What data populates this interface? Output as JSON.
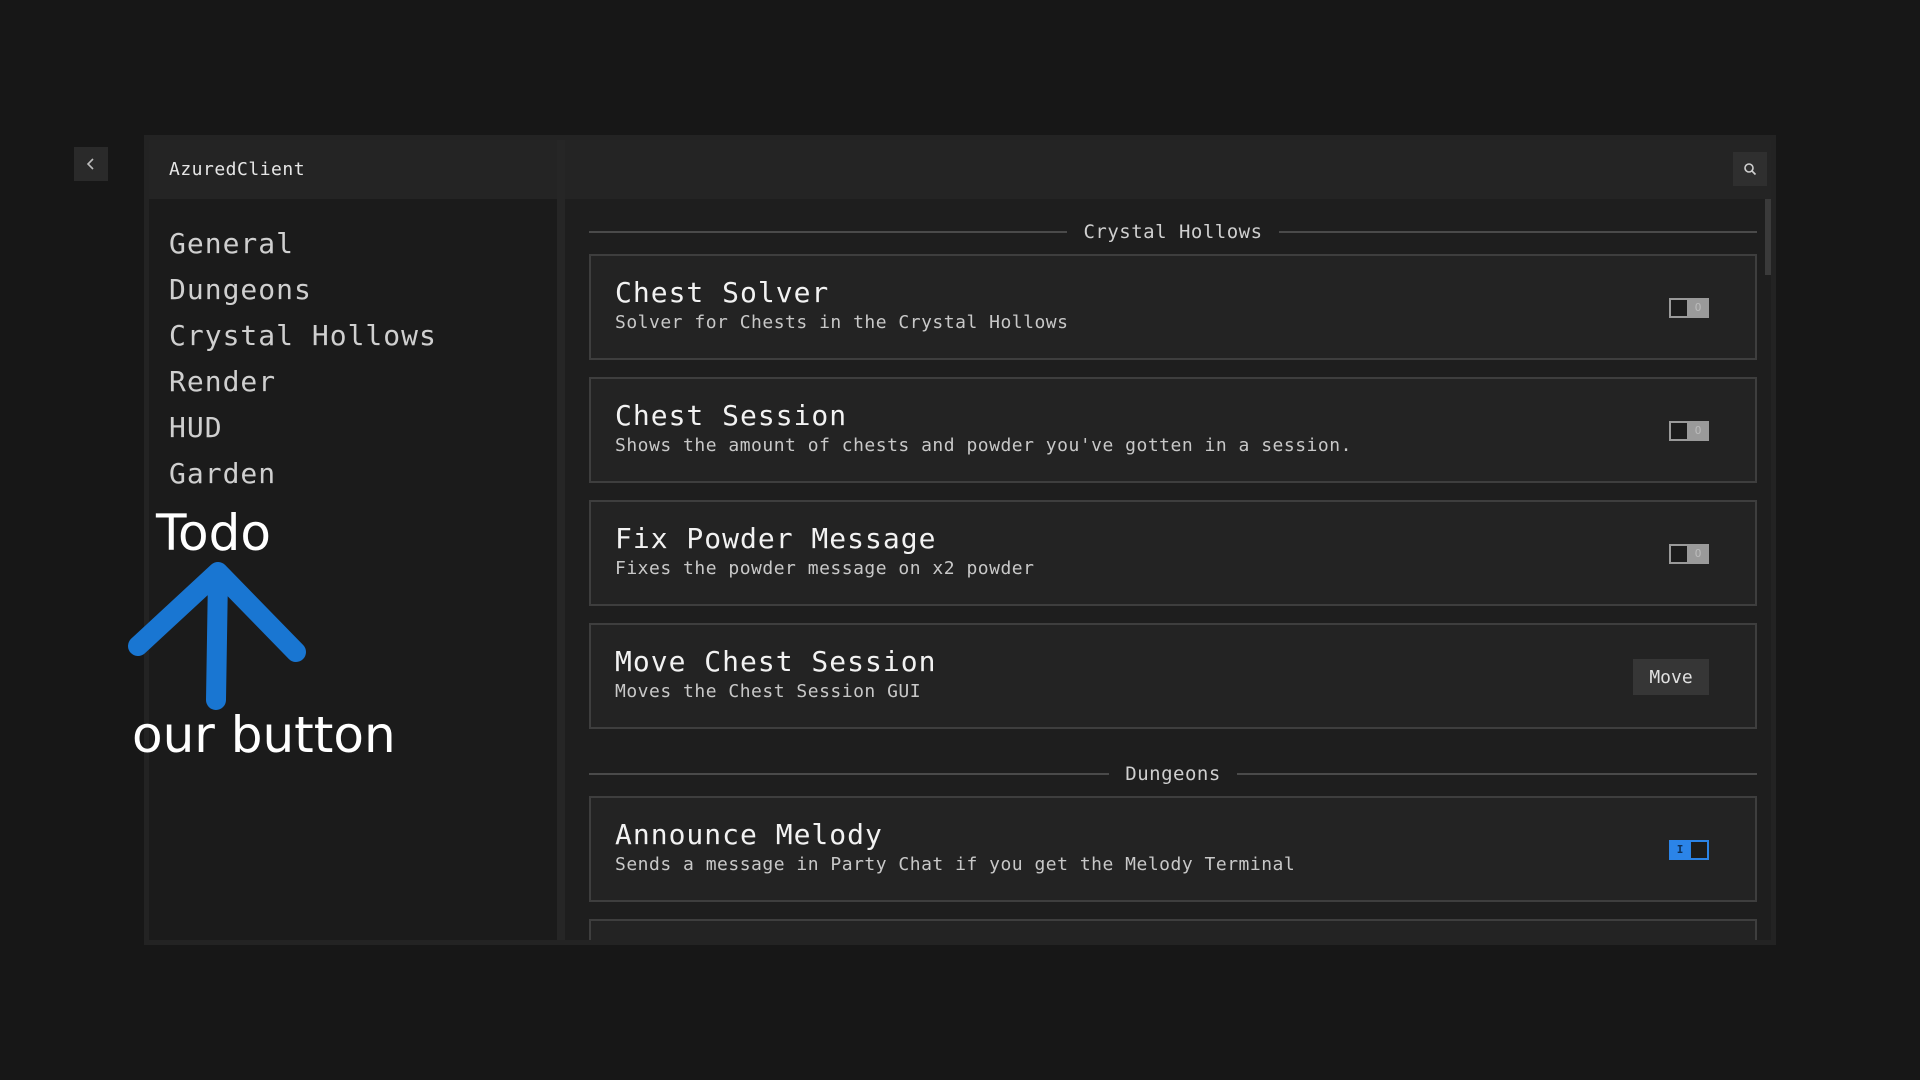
{
  "window": {
    "title": "AzuredClient"
  },
  "sidebar": {
    "items": [
      {
        "label": "General"
      },
      {
        "label": "Dungeons"
      },
      {
        "label": "Crystal Hollows"
      },
      {
        "label": "Render"
      },
      {
        "label": "HUD"
      },
      {
        "label": "Garden"
      }
    ]
  },
  "icons": {
    "back": "chevron-left-icon",
    "search": "search-icon"
  },
  "sections": [
    {
      "title": "Crystal Hollows",
      "features": [
        {
          "title": "Chest Solver",
          "description": "Solver for Chests in the Crystal Hollows",
          "control": "toggle",
          "enabled": false,
          "toggle_mark": "O"
        },
        {
          "title": "Chest Session",
          "description": "Shows the amount of chests and powder you've gotten in a session.",
          "control": "toggle",
          "enabled": false,
          "toggle_mark": "O"
        },
        {
          "title": "Fix Powder Message",
          "description": "Fixes the powder message on x2 powder",
          "control": "toggle",
          "enabled": false,
          "toggle_mark": "O"
        },
        {
          "title": "Move Chest Session",
          "description": "Moves the Chest Session GUI",
          "control": "button",
          "button_label": "Move"
        }
      ]
    },
    {
      "title": "Dungeons",
      "features": [
        {
          "title": "Announce Melody",
          "description": "Sends a message in Party Chat if you get the Melody Terminal",
          "control": "toggle",
          "enabled": true,
          "toggle_mark": "I"
        }
      ]
    }
  ],
  "annotation": {
    "label": "Todo",
    "caption": "our button",
    "color": "#1976d2"
  },
  "colors": {
    "background": "#171717",
    "accent": "#2b84e8"
  }
}
